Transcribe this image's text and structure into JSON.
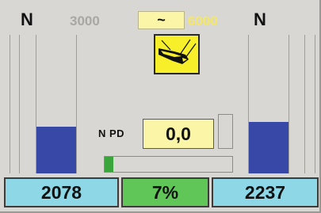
{
  "header": {
    "left_label": "N",
    "right_label": "N",
    "speed_low": "3000",
    "speed_mode": "~",
    "speed_high": "6000"
  },
  "icon": {
    "name": "brush-cutter-icon"
  },
  "gauges": {
    "left": {
      "level_percent": 34
    },
    "right": {
      "level_percent": 37
    }
  },
  "pd": {
    "label": "N  PD",
    "value": "0,0"
  },
  "progress": {
    "percent": 7
  },
  "readouts": {
    "left": "2078",
    "middle": "7%",
    "right": "2237"
  },
  "colors": {
    "panel": "#d8d7d3",
    "gauge_fill": "#3748a6",
    "progress_fill": "#3aa53a",
    "readout_side": "#8dd7e6",
    "readout_mid": "#5fc657",
    "value_box": "#fbf6a7",
    "icon_tile": "#f6ef2a"
  }
}
